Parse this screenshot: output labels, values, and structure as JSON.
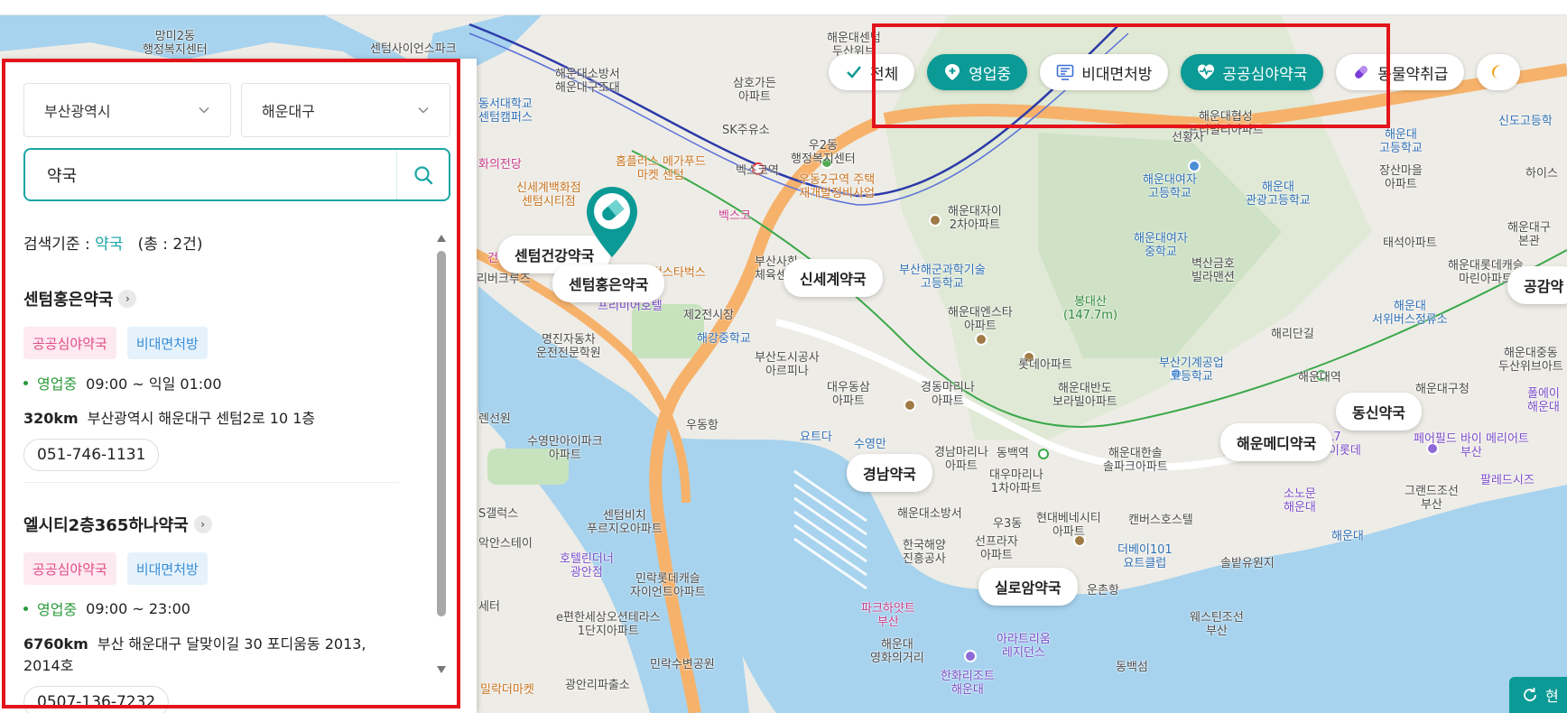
{
  "panel": {
    "city_select": "부산광역시",
    "district_select": "해운대구",
    "search_value": "약국",
    "criteria_prefix": "검색기준 : ",
    "criteria_keyword": "약국",
    "criteria_total": "(총 : 2건)",
    "results": [
      {
        "name": "센텀홍은약국",
        "tags": [
          "공공심야약국",
          "비대면처방"
        ],
        "status": "영업중",
        "hours": "09:00 ~ 익일 01:00",
        "distance": "320km",
        "address": "부산광역시 해운대구 센텀2로 10 1층",
        "phone": "051-746-1131"
      },
      {
        "name": "엘시티2층365하나약국",
        "tags": [
          "공공심야약국",
          "비대면처방"
        ],
        "status": "영업중",
        "hours": "09:00 ~ 23:00",
        "distance": "6760km",
        "address": "부산 해운대구 달맞이길 30 포디움동 2013, 2014호",
        "phone": "0507-136-7232"
      }
    ]
  },
  "filters": {
    "all": "전체",
    "open": "영업중",
    "remote": "비대면처방",
    "night": "공공심야약국",
    "animal": "동물약취급"
  },
  "map": {
    "pharmacy_labels": [
      "센텀건강약국",
      "센텀홍은약국",
      "신세계약국",
      "동신약국",
      "해운메디약국",
      "경남약국",
      "실로암약국",
      "공감약"
    ],
    "place_labels": {
      "l1": "망미2동\n행정복지센터",
      "l2": "해운대소방서\n해운대구조대",
      "l3": "삼호가든\n아파트",
      "l4": "동서대학교\n센텀캠퍼스",
      "l5": "SK주유소",
      "l6": "우2동\n행정복지센터",
      "l7": "홈플러스 메가푸드\n마켓 센텀",
      "l8": "신세계백화점\n센텀시티점",
      "l9": "벡스코역",
      "l10": "벡스코",
      "l11": "우동2구역 주택\n재개발정비사업",
      "l12": "해운대자이\n2차아파트",
      "l13": "부산해군과학기술\n고등학교",
      "l14": "해운대엔스타\n아파트",
      "l15": "봉대산\n(147.7m)",
      "l16": "롯데아파트",
      "l17": "제2전시장",
      "l18": "해강중학교",
      "l19": "명진자동차\n운전전문학원",
      "l20": "부산도시공사\n아르피나",
      "l21": "대우동삼\n아파트",
      "l22": "경동마리나\n아파트",
      "l23": "해운대반도\n보라빌아파트",
      "l24": "수영만아이파크\n아파트",
      "l25": "우동항",
      "l26": "요트다",
      "l27": "수영만",
      "l28": "경남마리나\n아파트",
      "l29": "동백역",
      "l30": "대우마리나\n1차아파트",
      "l31": "해운대한솔\n솔파크아파트",
      "l32": "해운대소방서",
      "l33": "현대베네시티\n아파트",
      "l34": "캔버스호스텔",
      "l35": "우3동",
      "l36": "선프라자\n아파트",
      "l37": "한국해양\n진흥공사",
      "l38": "센텀비치\n푸르지오아파트",
      "l39": "호텔린더너\n광안점",
      "l40": "민락롯데캐슬\n자이언트아파트",
      "l41": "e편한세상오션테라스\n1단지아파트",
      "l42": "민락수변공원",
      "l43": "광안리파출소",
      "l44": "밀락더마켓",
      "l45": "파크하얏트\n부산",
      "l46": "해운대\n영화의거리",
      "l47": "아라트리움\n레지던스",
      "l48": "한화리조트\n해운대",
      "l49": "동백섬",
      "l50": "웨스틴조선\n부산",
      "l51": "운촌항",
      "l52": "더베이101\n요트클럽",
      "l53": "솔밭유원지",
      "l54": "해운대",
      "l55": "그랜드조선\n부산",
      "l56": "소노문\n해운대",
      "l57": "팔레드시즈",
      "l58": "페어필드 바이 메리어트\n부산",
      "l59": "L7\n대비이롯데",
      "l60": "해운대구청",
      "l61": "해운대역",
      "l62": "부산기계공업\n고등학교",
      "l63": "해리단길",
      "l64": "해운대\n서위버스정류소",
      "l65": "해운대롯데캐슬\n마린아파트",
      "l66": "벽산금호\n빌라맨션",
      "l67": "해운대여자\n중학교",
      "l68": "해운대여자\n고등학교",
      "l69": "해운대\n관광고등학교",
      "l70": "태석아파트",
      "l71": "장산마을\n아파트",
      "l72": "해운대\n고등학교",
      "l73": "신도고등학",
      "l74": "해운대협성\n프리빌리아파트",
      "l75": "선황사",
      "l76": "해운대센텀\n두산위브",
      "l77": "센텀사이언스파크",
      "l78": "리버크루즈",
      "l79": "부산사회\n체육센터",
      "l80": "화의전당",
      "l81": "센텀스타벅스",
      "l82": "프리미어호텔",
      "l83": "건강센터",
      "l84": "렌선원",
      "l85": "S갤럭스",
      "l86": "악안스테이",
      "l87": "세터",
      "l88": "해운대구\n본관",
      "l89": "해운대중동\n두산위브아트",
      "l90": "폴에이\n해운대",
      "l91": "하이스",
      "l92": "공감약"
    }
  },
  "buttons": {
    "reset": "현"
  },
  "colors": {
    "accent": "#0b9a96",
    "highlight": "#e3141b"
  }
}
